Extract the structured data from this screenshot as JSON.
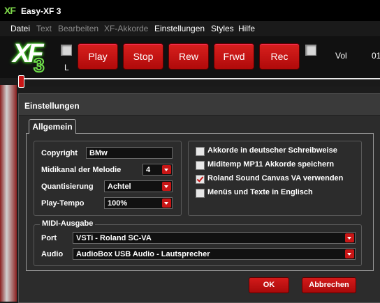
{
  "window": {
    "logo": "XF",
    "title": "Easy-XF 3"
  },
  "menu": [
    "Datei",
    "Text",
    "Bearbeiten",
    "XF-Akkorde",
    "Einstellungen",
    "Styles",
    "Hilfe"
  ],
  "toolbar": {
    "l_label": "L",
    "play": "Play",
    "stop": "Stop",
    "rew": "Rew",
    "frwd": "Frwd",
    "rec": "Rec",
    "vol_label": "Vol",
    "vol_value": "01"
  },
  "dialog": {
    "title": "Einstellungen",
    "tab": "Allgemein",
    "copyright_label": "Copyright",
    "copyright_value": "BMw",
    "midikanal_label": "Midikanal der Melodie",
    "midikanal_value": "4",
    "quant_label": "Quantisierung",
    "quant_value": "Achtel",
    "tempo_label": "Play-Tempo",
    "tempo_value": "100%",
    "options": [
      {
        "label": "Akkorde in deutscher Schreibweise",
        "checked": false
      },
      {
        "label": "Miditemp MP11 Akkorde speichern",
        "checked": false
      },
      {
        "label": "Roland Sound Canvas VA verwenden",
        "checked": true
      },
      {
        "label": "Menüs und Texte in Englisch",
        "checked": false
      }
    ],
    "midi_group": "MIDI-Ausgabe",
    "port_label": "Port",
    "port_value": "VSTi - Roland SC-VA",
    "audio_label": "Audio",
    "audio_value": "AudioBox USB Audio - Lautsprecher",
    "ok": "OK",
    "cancel": "Abbrechen"
  },
  "colors": {
    "accent_red": "#c81616",
    "background": "#2c2c2c"
  }
}
